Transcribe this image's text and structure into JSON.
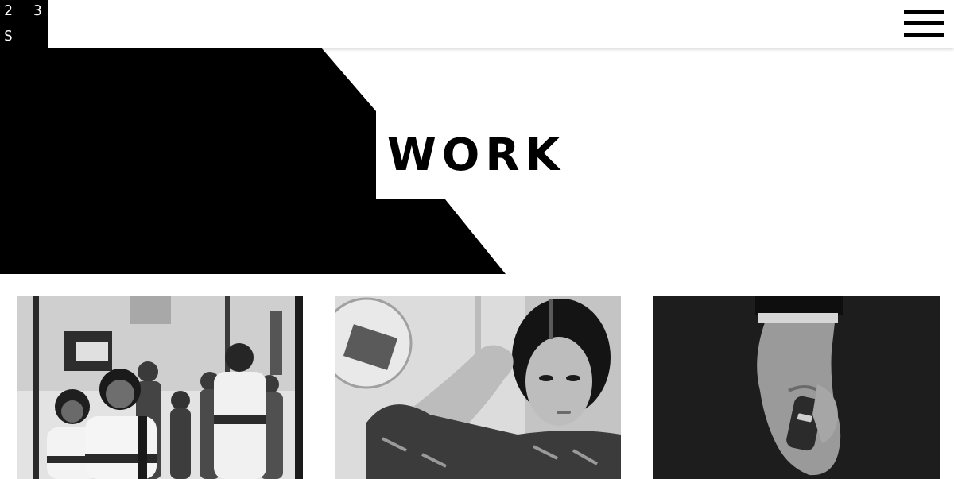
{
  "logo": {
    "chars": [
      "2",
      "3",
      "S"
    ]
  },
  "header": {
    "menu_icon": "hamburger-menu-icon"
  },
  "hero": {
    "title": "WORK",
    "shape_color": "#000000"
  },
  "projects": [
    {
      "image": "children-walking-school-hallway-photo"
    },
    {
      "image": "woman-adjusting-hair-photo"
    },
    {
      "image": "hand-holding-car-key-photo"
    }
  ],
  "colors": {
    "background": "#ffffff",
    "ink": "#000000"
  }
}
